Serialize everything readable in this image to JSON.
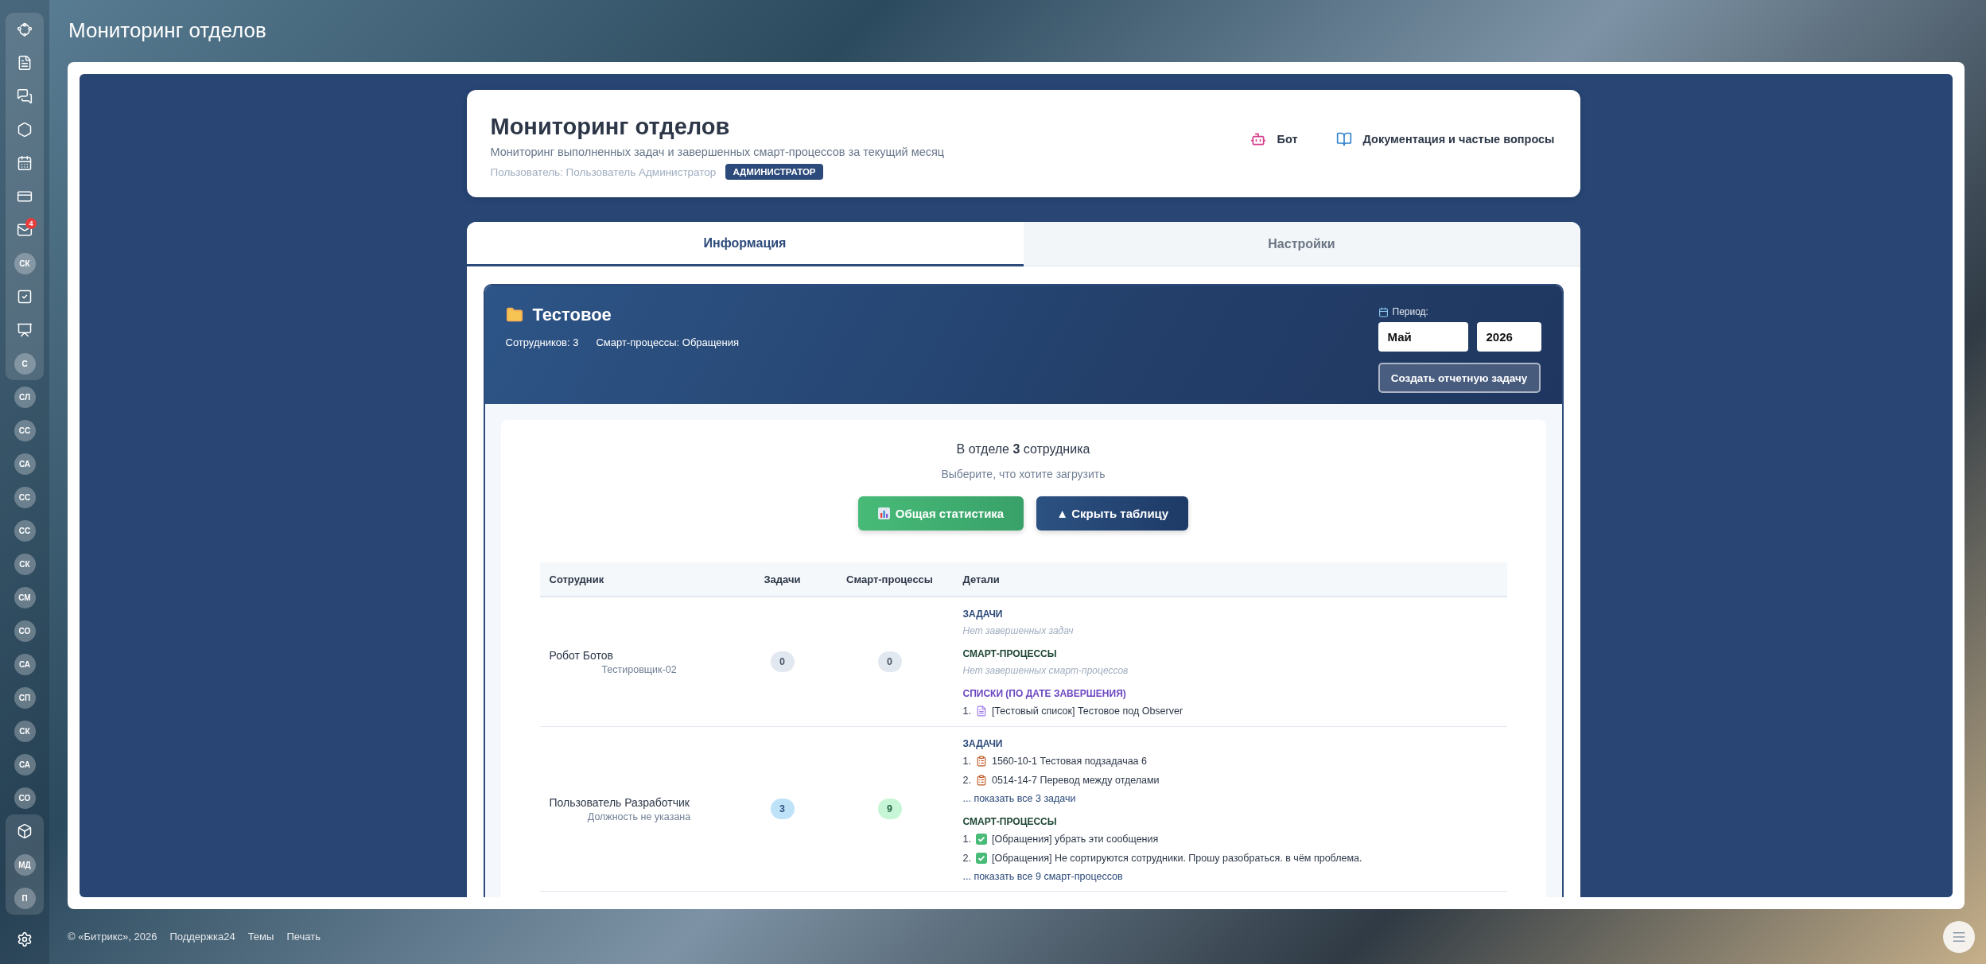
{
  "page_title": "Мониторинг отделов",
  "sidebar": {
    "top_group": [
      {
        "kind": "icon"
      },
      {
        "kind": "icon"
      },
      {
        "kind": "icon"
      },
      {
        "kind": "icon"
      },
      {
        "kind": "icon"
      },
      {
        "kind": "icon"
      },
      {
        "kind": "icon",
        "badge": "4"
      },
      {
        "kind": "avatar",
        "initials": "СК"
      },
      {
        "kind": "icon"
      },
      {
        "kind": "icon"
      },
      {
        "kind": "avatar",
        "initials": "С"
      }
    ],
    "items": [
      {
        "kind": "avatar",
        "initials": "СЛ"
      },
      {
        "kind": "avatar",
        "initials": "СС"
      },
      {
        "kind": "avatar",
        "initials": "СА"
      },
      {
        "kind": "avatar",
        "initials": "СС"
      },
      {
        "kind": "avatar",
        "initials": "СС"
      },
      {
        "kind": "avatar",
        "initials": "СК"
      },
      {
        "kind": "avatar",
        "initials": "СМ"
      },
      {
        "kind": "avatar",
        "initials": "СО"
      },
      {
        "kind": "avatar",
        "initials": "СА"
      },
      {
        "kind": "avatar",
        "initials": "СП"
      },
      {
        "kind": "avatar",
        "initials": "СК"
      },
      {
        "kind": "avatar",
        "initials": "СА"
      },
      {
        "kind": "avatar",
        "initials": "СО"
      }
    ],
    "bottom_group": [
      {
        "kind": "icon"
      },
      {
        "kind": "avatar",
        "initials": "МД"
      },
      {
        "kind": "avatar",
        "initials": "П"
      }
    ]
  },
  "header": {
    "title": "Мониторинг отделов",
    "subtitle": "Мониторинг выполненных задач и завершенных смарт-процессов за текущий месяц",
    "user_label": "Пользователь: Пользователь Администратор",
    "role_badge": "АДМИНИСТРАТОР",
    "links": [
      {
        "label": "Бот"
      },
      {
        "label": "Документация и частые вопросы"
      }
    ]
  },
  "tabs": [
    {
      "label": "Информация",
      "selected": true
    },
    {
      "label": "Настройки",
      "selected": false
    }
  ],
  "department": {
    "name": "Тестовое",
    "employees": "Сотрудников: 3",
    "smart_processes": "Смарт-процессы: Обращения",
    "period": {
      "label": "Период:",
      "month": "Май",
      "year": "2026"
    },
    "create_button": "Создать отчетную задачу"
  },
  "summary": {
    "text": "В отделе **3** сотрудника",
    "hint": "Выберите, что хотите загрузить",
    "buttons": [
      {
        "kind": "stats",
        "label": "Общая статистика"
      },
      {
        "kind": "toggle",
        "label": "▲ Скрыть таблицу"
      }
    ]
  },
  "table": {
    "columns": [
      "Сотрудник",
      "Задачи",
      "Смарт-процессы",
      "Детали"
    ],
    "rows": [
      {
        "name": "Робот Ботов",
        "position": "Тестировщик-02",
        "tasks": {
          "count": "0",
          "color": "#e2e8f0"
        },
        "smart": {
          "count": "0",
          "color": "#e2e8f0"
        },
        "details": [
          {
            "kind": "tasks",
            "title": "ЗАДАЧИ",
            "empty": "Нет завершенных задач"
          },
          {
            "kind": "smart",
            "title": "СМАРТ-ПРОЦЕССЫ",
            "empty": "Нет завершенных смарт-процессов"
          },
          {
            "kind": "lists",
            "title": "СПИСКИ (ПО ДАТЕ ЗАВЕРШЕНИЯ)",
            "items": [
              {
                "number": "1.",
                "text": "[Тестовый список] Тестовое под Observer"
              }
            ]
          }
        ]
      },
      {
        "name": "Пользователь Разработчик",
        "position": "Должность не указана",
        "tasks": {
          "count": "3",
          "color": "#bee3f8"
        },
        "smart": {
          "count": "9",
          "color": "#c6f6d5"
        },
        "details": [
          {
            "kind": "tasks",
            "title": "ЗАДАЧИ",
            "items": [
              {
                "number": "1.",
                "text": "1560-10-1 Тестовая подзадачаа 6"
              },
              {
                "number": "2.",
                "text": "0514-14-7 Перевод между отделами"
              }
            ],
            "more": "... показать все 3 задачи"
          },
          {
            "kind": "smart",
            "title": "СМАРТ-ПРОЦЕССЫ",
            "items": [
              {
                "number": "1.",
                "text": "[Обращения] убрать эти сообщения"
              },
              {
                "number": "2.",
                "text": "[Обращения] Не сортируются сотрудники. Прошу разобраться. в чём проблема."
              }
            ],
            "more": "... показать все 9 смарт-процессов"
          }
        ]
      }
    ]
  },
  "footer": {
    "copyright": "© «Битрикс», 2026",
    "links": [
      "Поддержка24",
      "Темы",
      "Печать"
    ]
  }
}
